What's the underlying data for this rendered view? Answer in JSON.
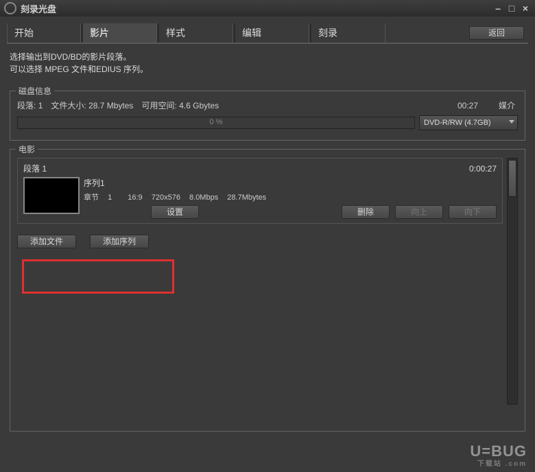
{
  "window": {
    "title": "刻录光盘"
  },
  "win_controls": {
    "min": "–",
    "max": "□",
    "close": "×"
  },
  "tabs": {
    "items": [
      {
        "label": "开始"
      },
      {
        "label": "影片"
      },
      {
        "label": "样式"
      },
      {
        "label": "编辑"
      },
      {
        "label": "刻录"
      }
    ],
    "active_index": 1,
    "back_label": "返回"
  },
  "hint": {
    "line1": "选择输出到DVD/BD的影片段落。",
    "line2": "可以选择 MPEG 文件和EDIUS 序列。"
  },
  "disk": {
    "group_title": "磁盘信息",
    "segments_label": "段落:",
    "segments_value": "1",
    "filesize_label": "文件大小:",
    "filesize_value": "28.7 Mbytes",
    "freespace_label": "可用空间:",
    "freespace_value": "4.6 Gbytes",
    "time": "00:27",
    "media_label": "媒介",
    "progress_pct": "0 %",
    "media_selected": "DVD-R/RW (4.7GB)"
  },
  "movie": {
    "group_title": "电影",
    "segment_title": "段落 1",
    "segment_duration": "0:00:27",
    "sequence_name": "序列1",
    "meta": {
      "chapter_label": "章节",
      "chapter_value": "1",
      "aspect": "16:9",
      "resolution": "720x576",
      "bitrate": "8.0Mbps",
      "size": "28.7Mbytes"
    },
    "settings_label": "设置",
    "delete_label": "删除",
    "up_label": "向上",
    "down_label": "向下",
    "add_file_label": "添加文件",
    "add_seq_label": "添加序列"
  },
  "watermark": {
    "brand": "U=BUG",
    "sub": "下载站 .com"
  }
}
